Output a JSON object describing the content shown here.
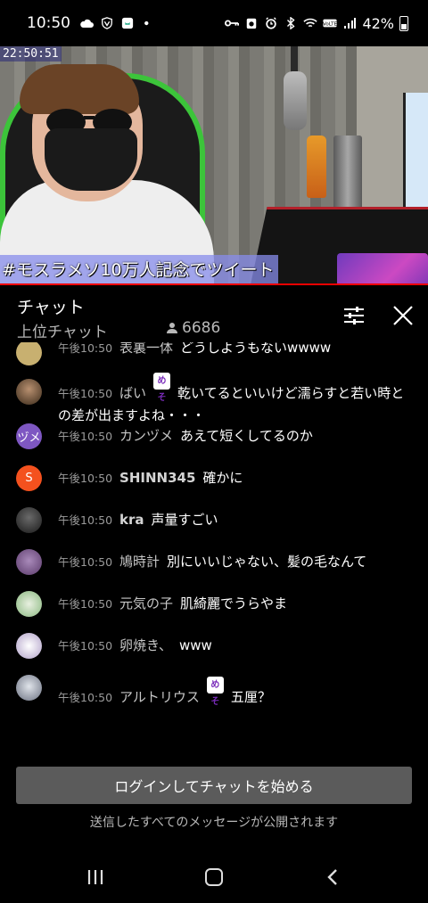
{
  "status_bar": {
    "time": "10:50",
    "battery": "42%",
    "icons_left": [
      "cloud-icon",
      "vpn-shield-icon",
      "app-notification-icon",
      "dot-icon"
    ],
    "icons_right": [
      "key-icon",
      "recorder-icon",
      "alarm-icon",
      "bluetooth-icon",
      "wifi-icon",
      "volte-icon",
      "signal-icon",
      "battery-icon"
    ]
  },
  "video": {
    "timestamp": "22:50:51",
    "caption": "#モスラメソ10万人記念でツイート",
    "progress_color": "#e00000"
  },
  "chat": {
    "title": "チャット",
    "mode": "上位チャット",
    "viewer_count": "6686",
    "filter_icon": "sliders-icon",
    "close_icon": "close-icon"
  },
  "messages": [
    {
      "time": "午後10:50",
      "author": "表裏一体",
      "badge": "",
      "text": "どうしようもないwwww",
      "avatar_color": "#c8b070",
      "avatar_text": ""
    },
    {
      "time": "午後10:50",
      "author": "ばい",
      "badge": "めそ",
      "text": "乾いてるといいけど濡らすと若い時との差が出ますよね・・・",
      "avatar_color": "#7a5a40",
      "avatar_text": ""
    },
    {
      "time": "午後10:50",
      "author": "カンヅメ",
      "badge": "",
      "text": "あえて短くしてるのか",
      "avatar_color": "#7e57c2",
      "avatar_text": "ヅメ"
    },
    {
      "time": "午後10:50",
      "author": "SHINN345",
      "badge": "",
      "text": "確かに",
      "avatar_color": "#f4511e",
      "avatar_text": "S"
    },
    {
      "time": "午後10:50",
      "author": "kra",
      "badge": "",
      "text": "声量すごい",
      "avatar_color": "#3a3a3a",
      "avatar_text": ""
    },
    {
      "time": "午後10:50",
      "author": "鳩時計",
      "badge": "",
      "text": "別にいいじゃない、髪の毛なんて",
      "avatar_color": "#8a6a9a",
      "avatar_text": ""
    },
    {
      "time": "午後10:50",
      "author": "元気の子",
      "badge": "",
      "text": "肌綺麗でうらやま",
      "avatar_color": "#a9c9a0",
      "avatar_text": ""
    },
    {
      "time": "午後10:50",
      "author": "卵焼き、",
      "badge": "",
      "text": "www",
      "avatar_color": "#d8d8e8",
      "avatar_text": ""
    },
    {
      "time": "午後10:50",
      "author": "アルトリウス",
      "badge": "めそ",
      "text": "五厘？",
      "avatar_color": "#9aa0b0",
      "avatar_text": ""
    }
  ],
  "footer": {
    "login_button": "ログインしてチャットを始める",
    "notice": "送信したすべてのメッセージが公開されます"
  },
  "nav": {
    "recent": "recent-apps-icon",
    "home": "home-icon",
    "back": "back-icon"
  }
}
